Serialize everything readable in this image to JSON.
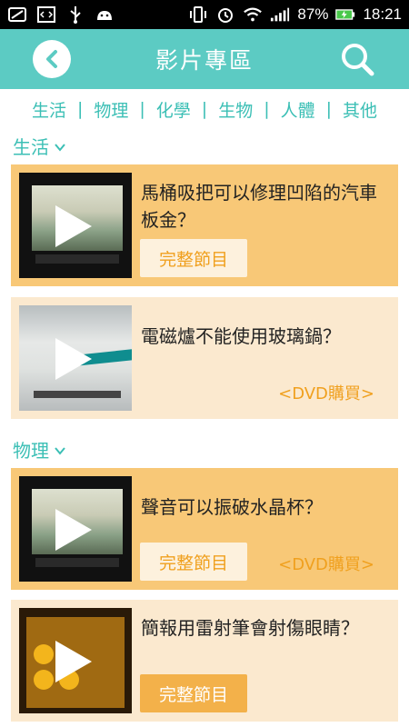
{
  "status_bar": {
    "battery": "87%",
    "time": "18:21"
  },
  "header": {
    "title": "影片專區"
  },
  "tabs": [
    "生活",
    "物理",
    "化學",
    "生物",
    "人體",
    "其他"
  ],
  "tab_separator": "|",
  "sections": [
    {
      "title": "生活",
      "items": [
        {
          "title": "馬桶吸把可以修理凹陷的汽車板金？",
          "full_label": "完整節目",
          "dvd_label": ""
        },
        {
          "title": "電磁爐不能使用玻璃鍋？",
          "full_label": "",
          "dvd_label": "<DVD購買>"
        }
      ]
    },
    {
      "title": "物理",
      "items": [
        {
          "title": "聲音可以振破水晶杯？",
          "full_label": "完整節目",
          "dvd_label": "<DVD購買>"
        },
        {
          "title": "簡報用雷射筆會射傷眼睛？",
          "full_label": "完整節目",
          "dvd_label": ""
        }
      ]
    }
  ],
  "colors": {
    "header": "#5ccbc3",
    "accent": "#3bbfb5",
    "card_dark": "#f8c877",
    "card_light": "#fbe9cf",
    "orange": "#f0a01e"
  }
}
